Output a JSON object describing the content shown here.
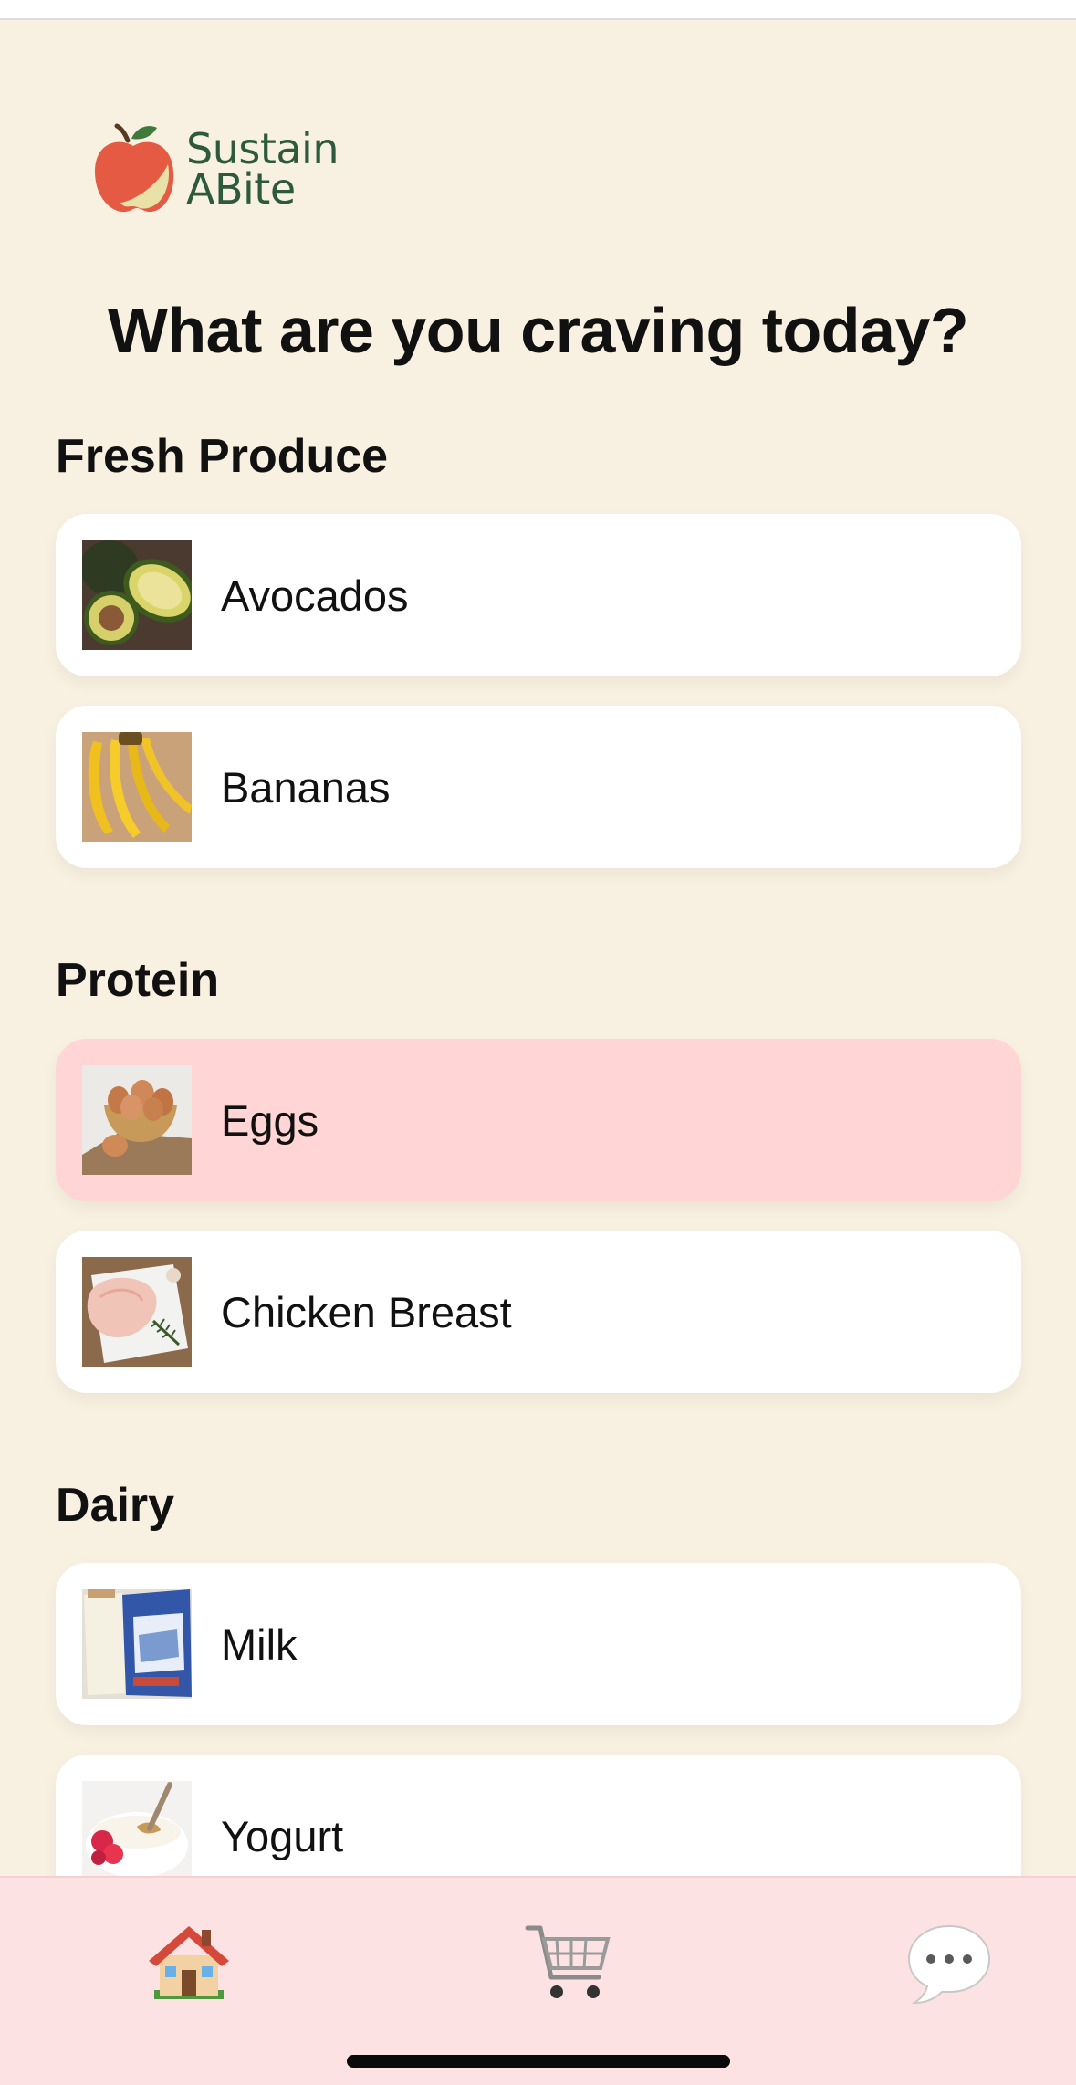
{
  "app": {
    "logo_line1": "Sustain",
    "logo_line2": "ABite",
    "brand_color": "#2d5a3d"
  },
  "page": {
    "title": "What are you craving today?"
  },
  "sections": [
    {
      "title": "Fresh Produce",
      "items": [
        {
          "label": "Avocados",
          "icon": "avocado-image",
          "selected": false
        },
        {
          "label": "Bananas",
          "icon": "banana-image",
          "selected": false
        }
      ]
    },
    {
      "title": "Protein",
      "items": [
        {
          "label": "Eggs",
          "icon": "eggs-image",
          "selected": true
        },
        {
          "label": "Chicken Breast",
          "icon": "chicken-breast-image",
          "selected": false
        }
      ]
    },
    {
      "title": "Dairy",
      "items": [
        {
          "label": "Milk",
          "icon": "milk-image",
          "selected": false
        },
        {
          "label": "Yogurt",
          "icon": "yogurt-image",
          "selected": false
        }
      ]
    }
  ],
  "nav": {
    "items": [
      {
        "name": "home",
        "icon": "house-icon"
      },
      {
        "name": "cart",
        "icon": "shopping-cart-icon"
      },
      {
        "name": "chat",
        "icon": "speech-bubble-icon"
      }
    ]
  },
  "colors": {
    "background": "#f8f0e0",
    "card": "#ffffff",
    "selected_card": "#ffd5d5",
    "nav_bar": "#fde2e4"
  }
}
